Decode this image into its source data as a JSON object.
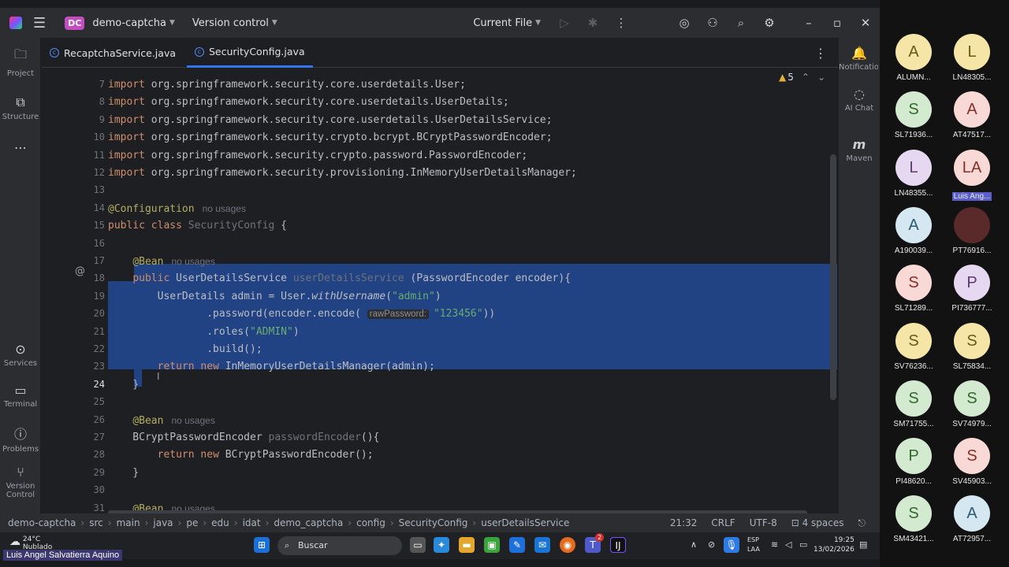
{
  "titlebar": {
    "project_badge": "DC",
    "project_name": "demo-captcha",
    "vcs": "Version control",
    "run_config": "Current File"
  },
  "leftbar": [
    "Project",
    "Structure",
    "Services",
    "Terminal",
    "Problems",
    "Version Control"
  ],
  "rightbar": [
    "Notifications",
    "AI Chat",
    "Maven"
  ],
  "tabs": [
    {
      "label": "RecaptchaService.java",
      "active": false
    },
    {
      "label": "SecurityConfig.java",
      "active": true
    }
  ],
  "editor": {
    "warnings": "5",
    "lines": [
      {
        "n": "7",
        "html": "<span class='kw'>import</span> org.springframework.security.core.userdetails.User;"
      },
      {
        "n": "8",
        "html": "<span class='kw'>import</span> org.springframework.security.core.userdetails.UserDetails;"
      },
      {
        "n": "9",
        "html": "<span class='kw'>import</span> org.springframework.security.core.userdetails.UserDetailsService;"
      },
      {
        "n": "10",
        "html": "<span class='kw'>import</span> org.springframework.security.crypto.bcrypt.BCryptPasswordEncoder;"
      },
      {
        "n": "11",
        "html": "<span class='kw'>import</span> org.springframework.security.crypto.password.PasswordEncoder;"
      },
      {
        "n": "12",
        "html": "<span class='kw'>import</span> org.springframework.security.provisioning.InMemoryUserDetailsManager;"
      },
      {
        "n": "13",
        "html": ""
      },
      {
        "n": "14",
        "html": "<span class='ann'>@Configuration</span><span class='hint'>no usages</span>"
      },
      {
        "n": "15",
        "html": "<span class='kw'>public class</span> <span class='gray'>SecurityConfig</span> {"
      },
      {
        "n": "16",
        "html": ""
      },
      {
        "n": "17",
        "html": "    <span class='ann'>@Bean</span><span class='hint'>no usages</span>"
      },
      {
        "n": "18",
        "html": "    <span class='kw'>public</span> UserDetailsService <span class='gray'>userDetailsService</span> (PasswordEncoder encoder){"
      },
      {
        "n": "19",
        "html": "        UserDetails admin = User.<span class='it'>withUsername</span>(<span class='str'>\"admin\"</span>)"
      },
      {
        "n": "20",
        "html": "                .password(encoder.encode( <span class='inlay'>rawPassword:</span><span class='str'>\"123456\"</span>))"
      },
      {
        "n": "21",
        "html": "                .roles(<span class='str'>\"ADMIN\"</span>)"
      },
      {
        "n": "22",
        "html": "                .build();"
      },
      {
        "n": "23",
        "html": "        <span class='kw'>return new</span> InMemoryUserDetailsManager(admin);"
      },
      {
        "n": "24",
        "html": "    }"
      },
      {
        "n": "25",
        "html": ""
      },
      {
        "n": "26",
        "html": "    <span class='ann'>@Bean</span><span class='hint'>no usages</span>"
      },
      {
        "n": "27",
        "html": "    BCryptPasswordEncoder <span class='gray'>passwordEncoder</span>(){"
      },
      {
        "n": "28",
        "html": "        <span class='kw'>return new</span> BCryptPasswordEncoder();"
      },
      {
        "n": "29",
        "html": "    }"
      },
      {
        "n": "30",
        "html": ""
      },
      {
        "n": "31",
        "html": "    <span class='ann'>@Bean</span><span class='hint'>no usages</span>"
      }
    ]
  },
  "statusbar": {
    "breadcrumb": [
      "demo-captcha",
      "src",
      "main",
      "java",
      "pe",
      "edu",
      "idat",
      "demo_captcha",
      "config",
      "SecurityConfig",
      "userDetailsService"
    ],
    "position": "21:32",
    "line_sep": "CRLF",
    "encoding": "UTF-8",
    "indent": "4 spaces"
  },
  "taskbar": {
    "temp": "24°C",
    "weather": "Nublado",
    "search": "Buscar",
    "lang1": "ESP",
    "lang2": "LAA",
    "time": "19:25",
    "date": "13/02/2026",
    "teams_badge": "2"
  },
  "presenter": "Luis Angel  Salvatierra Aquino",
  "participants": [
    {
      "initials": "A",
      "name": "ALUMN...",
      "color": "#f5e6a8",
      "fg": "#6b5a14"
    },
    {
      "initials": "L",
      "name": "LN48305...",
      "color": "#f5e6a8",
      "fg": "#6b5a14"
    },
    {
      "initials": "S",
      "name": "SL71936...",
      "color": "#d4ead0",
      "fg": "#2f6b2a"
    },
    {
      "initials": "A",
      "name": "AT47517...",
      "color": "#f8d9d6",
      "fg": "#8a2e25"
    },
    {
      "initials": "L",
      "name": "LN48355...",
      "color": "#e6d8f0",
      "fg": "#5b3b74"
    },
    {
      "initials": "LA",
      "name": "Luis Ang...",
      "color": "#f8d9d6",
      "fg": "#8a2e25",
      "hl": true
    },
    {
      "initials": "A",
      "name": "A190039...",
      "color": "#d5e7f0",
      "fg": "#2d5b73"
    },
    {
      "initials": "",
      "name": "PT76916...",
      "color": "#5a2a2a",
      "fg": "#fff",
      "photo": true
    },
    {
      "initials": "S",
      "name": "SL71289...",
      "color": "#f8d9d6",
      "fg": "#8a2e25"
    },
    {
      "initials": "P",
      "name": "PI736777...",
      "color": "#e6d8f0",
      "fg": "#5b3b74"
    },
    {
      "initials": "S",
      "name": "SV76236...",
      "color": "#f5e6a8",
      "fg": "#6b5a14"
    },
    {
      "initials": "S",
      "name": "SL75834...",
      "color": "#f5e6a8",
      "fg": "#6b5a14"
    },
    {
      "initials": "S",
      "name": "SM71755...",
      "color": "#d4ead0",
      "fg": "#2f6b2a"
    },
    {
      "initials": "S",
      "name": "SV74979...",
      "color": "#d4ead0",
      "fg": "#2f6b2a"
    },
    {
      "initials": "P",
      "name": "PI48620...",
      "color": "#d4ead0",
      "fg": "#2f6b2a"
    },
    {
      "initials": "S",
      "name": "SV45903...",
      "color": "#f8d9d6",
      "fg": "#8a2e25"
    },
    {
      "initials": "S",
      "name": "SM43421...",
      "color": "#d4ead0",
      "fg": "#2f6b2a"
    },
    {
      "initials": "A",
      "name": "AT72957...",
      "color": "#d5e7f0",
      "fg": "#2d5b73"
    }
  ]
}
